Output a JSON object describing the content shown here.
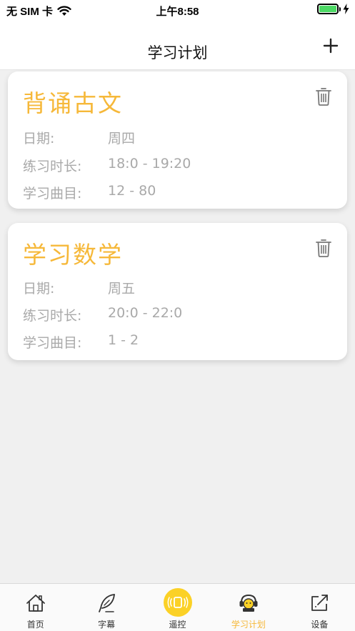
{
  "status_bar": {
    "carrier": "无 SIM 卡",
    "time": "上午8:58",
    "battery_color": "#4cd964"
  },
  "nav": {
    "title": "学习计划",
    "add_icon": "plus-icon"
  },
  "labels": {
    "date": "日期:",
    "duration": "练习时长:",
    "songs": "学习曲目:"
  },
  "plans": [
    {
      "title": "背诵古文",
      "date": "周四",
      "duration": "18:0 - 19:20",
      "songs": "12 - 80"
    },
    {
      "title": "学习数学",
      "date": "周五",
      "duration": "20:0 - 22:0",
      "songs": "1 - 2"
    }
  ],
  "tabs": [
    {
      "label": "首页",
      "icon": "home-icon"
    },
    {
      "label": "字幕",
      "icon": "quill-icon"
    },
    {
      "label": "遥控",
      "icon": "remote-icon"
    },
    {
      "label": "学习计划",
      "icon": "study-icon",
      "active": true
    },
    {
      "label": "设备",
      "icon": "device-icon"
    }
  ],
  "colors": {
    "accent": "#f6b839",
    "remote_bg": "#fbd126",
    "muted_text": "#a9a9a9",
    "background": "#f0f0f0"
  }
}
